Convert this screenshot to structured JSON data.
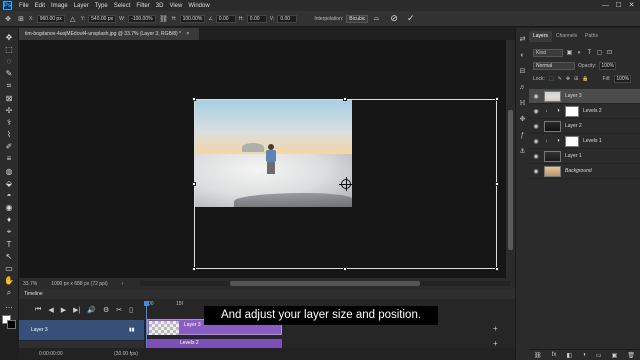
{
  "menu": {
    "app_logo": "Ps",
    "items": [
      "File",
      "Edit",
      "Image",
      "Layer",
      "Type",
      "Select",
      "Filter",
      "3D",
      "View",
      "Window"
    ],
    "win_min": "—",
    "win_max": "☐",
    "win_close": "✕"
  },
  "options": {
    "x_label": "X:",
    "x_value": "960.00 px",
    "y_label": "Y:",
    "y_value": "540.00 px",
    "w_label": "W:",
    "w_value": "-100.00%",
    "h_label": "H:",
    "h_value": "100.00%",
    "angle_label": "∠",
    "angle_value": "0.00",
    "hskew_label": "H:",
    "hskew_value": "0.00",
    "vskew_label": "V:",
    "vskew_value": "0.00",
    "interp_label": "Interpolation:",
    "interp_value": "Bicubic",
    "cancel": "⊘",
    "commit": "✓"
  },
  "tools": [
    "✥",
    "⬚",
    "◌",
    "✎",
    "⌗",
    "⊠",
    "✢",
    "⚕",
    "⌇",
    "✐",
    "≡",
    "◍",
    "⬙",
    "◓",
    "◉",
    "♦",
    "⌖",
    "T",
    "↖",
    "▭",
    "✋",
    "⌕",
    "…"
  ],
  "document": {
    "tab_label": "tim-bogdanov-4uojMEdcwl4-unsplash.jpg @ 33.7% (Layer 3, RGB/8) *",
    "close": "×"
  },
  "status": {
    "zoom": "33.7%",
    "doc_info": "1000 px x 688 px (72 ppi)",
    "arrow": "›"
  },
  "timeline": {
    "title": "Timeline",
    "controls": [
      "⏮",
      "◀",
      "▶",
      "▶|",
      "🔊",
      "⚙",
      "✂",
      "▯"
    ],
    "ruler_ticks": [
      "00",
      "15f"
    ],
    "track1_label": "Layer 3",
    "track1_icon": "▮▮",
    "clip1_label": "Layer 3",
    "clip2_label": "Levels 2",
    "foot_time": "0:00:00:00",
    "foot_fps": "(30.00 fps)",
    "add_plus": "+",
    "add_plus_2": "+"
  },
  "caption": "And adjust your layer size and position.",
  "panel_icons": [
    "⇄",
    "◐",
    "⊟",
    "♬",
    "ℍ",
    "✥",
    "ƒ",
    "⚓"
  ],
  "layers_panel": {
    "tabs": [
      "Layers",
      "Channels",
      "Paths"
    ],
    "kind_label": "Kind",
    "blend_mode": "Normal",
    "opacity_label": "Opacity:",
    "opacity_value": "100%",
    "lock_label": "Lock:",
    "fill_label": "Fill:",
    "fill_value": "100%",
    "layers": [
      {
        "name": "Layer 3",
        "selected": true,
        "type": "smart"
      },
      {
        "name": "Levels 2",
        "selected": false,
        "type": "adjustment"
      },
      {
        "name": "Layer 2",
        "selected": false,
        "type": "pixel"
      },
      {
        "name": "Levels 1",
        "selected": false,
        "type": "adjustment"
      },
      {
        "name": "Layer 1",
        "selected": false,
        "type": "pixel"
      },
      {
        "name": "Background",
        "selected": false,
        "type": "background"
      }
    ],
    "bottom_icons": [
      "⛓",
      "fx",
      "◧",
      "◑",
      "▭",
      "▣",
      "🗑"
    ]
  }
}
